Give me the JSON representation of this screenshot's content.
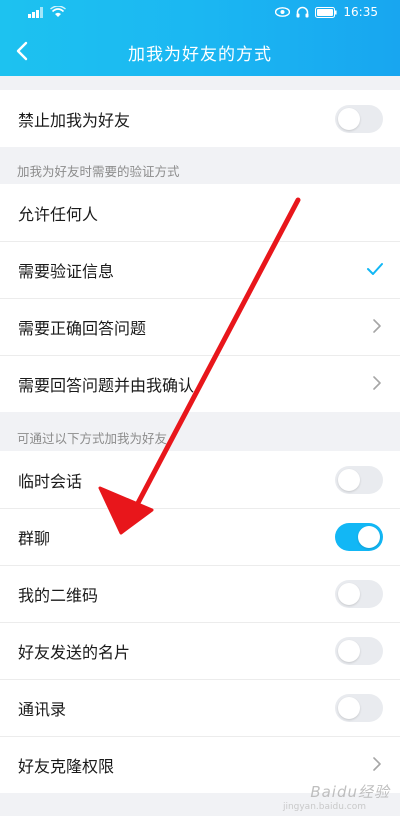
{
  "status": {
    "time": "16:35"
  },
  "nav": {
    "title": "加我为好友的方式"
  },
  "block_all": {
    "label": "禁止加我为好友",
    "on": false
  },
  "verification": {
    "section_label": "加我为好友时需要的验证方式",
    "items": [
      {
        "label": "允许任何人"
      },
      {
        "label": "需要验证信息",
        "selected": true
      },
      {
        "label": "需要正确回答问题"
      },
      {
        "label": "需要回答问题并由我确认"
      }
    ]
  },
  "methods": {
    "section_label": "可通过以下方式加我为好友",
    "items": [
      {
        "label": "临时会话",
        "on": false
      },
      {
        "label": "群聊",
        "on": true
      },
      {
        "label": "我的二维码",
        "on": false
      },
      {
        "label": "好友发送的名片",
        "on": false
      },
      {
        "label": "通讯录",
        "on": false
      },
      {
        "label": "好友克隆权限"
      }
    ]
  },
  "watermark": {
    "text": "Baidu经验",
    "sub": "jingyan.baidu.com"
  },
  "colors": {
    "accent": "#12b7f5",
    "arrow": "#e8161b",
    "header_start": "#1dc2f0",
    "header_end": "#18a6f0"
  }
}
